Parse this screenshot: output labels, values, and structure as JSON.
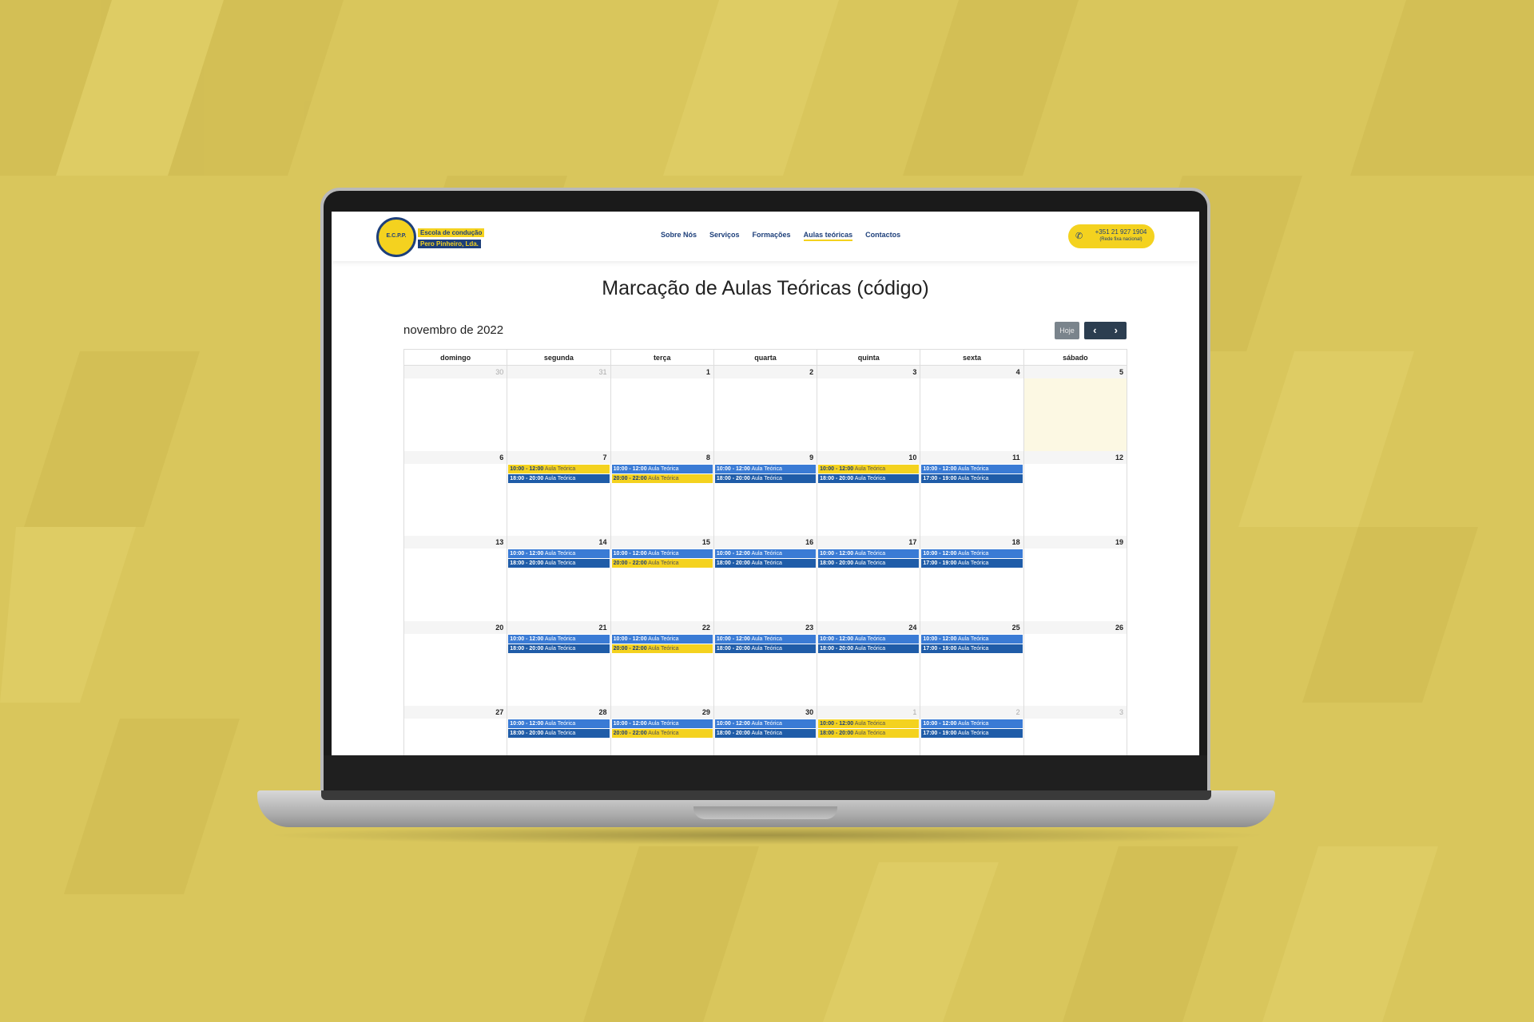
{
  "header": {
    "logo_badge": "E.C.P.P.",
    "logo_line1": "Escola de condução",
    "logo_line2": "Pero Pinheiro, Lda.",
    "nav": [
      {
        "label": "Sobre Nós",
        "active": false
      },
      {
        "label": "Serviços",
        "active": false
      },
      {
        "label": "Formações",
        "active": false
      },
      {
        "label": "Aulas teóricas",
        "active": true
      },
      {
        "label": "Contactos",
        "active": false
      }
    ],
    "phone_number": "+351 21 927 1904",
    "phone_note": "(Rede fixa nacional)"
  },
  "page_title": "Marcação de Aulas Teóricas (código)",
  "calendar": {
    "month_title": "novembro de 2022",
    "today_label": "Hoje",
    "prev_label": "‹",
    "next_label": "›",
    "weekdays": [
      "domingo",
      "segunda",
      "terça",
      "quarta",
      "quinta",
      "sexta",
      "sábado"
    ],
    "weeks": [
      [
        {
          "day": "30",
          "other": true,
          "events": []
        },
        {
          "day": "31",
          "other": true,
          "events": []
        },
        {
          "day": "1",
          "events": []
        },
        {
          "day": "2",
          "events": []
        },
        {
          "day": "3",
          "events": []
        },
        {
          "day": "4",
          "events": []
        },
        {
          "day": "5",
          "today": true,
          "events": []
        }
      ],
      [
        {
          "day": "6",
          "events": []
        },
        {
          "day": "7",
          "events": [
            {
              "time": "10:00 - 12:00",
              "name": "Aula Teórica",
              "color": "yellow"
            },
            {
              "time": "18:00 - 20:00",
              "name": "Aula Teórica",
              "color": "dblue"
            }
          ]
        },
        {
          "day": "8",
          "events": [
            {
              "time": "10:00 - 12:00",
              "name": "Aula Teórica",
              "color": "blue"
            },
            {
              "time": "20:00 - 22:00",
              "name": "Aula Teórica",
              "color": "yellow"
            }
          ]
        },
        {
          "day": "9",
          "events": [
            {
              "time": "10:00 - 12:00",
              "name": "Aula Teórica",
              "color": "blue"
            },
            {
              "time": "18:00 - 20:00",
              "name": "Aula Teórica",
              "color": "dblue"
            }
          ]
        },
        {
          "day": "10",
          "events": [
            {
              "time": "10:00 - 12:00",
              "name": "Aula Teórica",
              "color": "yellow"
            },
            {
              "time": "18:00 - 20:00",
              "name": "Aula Teórica",
              "color": "dblue"
            }
          ]
        },
        {
          "day": "11",
          "events": [
            {
              "time": "10:00 - 12:00",
              "name": "Aula Teórica",
              "color": "blue"
            },
            {
              "time": "17:00 - 19:00",
              "name": "Aula Teórica",
              "color": "dblue"
            }
          ]
        },
        {
          "day": "12",
          "events": []
        }
      ],
      [
        {
          "day": "13",
          "events": []
        },
        {
          "day": "14",
          "events": [
            {
              "time": "10:00 - 12:00",
              "name": "Aula Teórica",
              "color": "blue"
            },
            {
              "time": "18:00 - 20:00",
              "name": "Aula Teórica",
              "color": "dblue"
            }
          ]
        },
        {
          "day": "15",
          "events": [
            {
              "time": "10:00 - 12:00",
              "name": "Aula Teórica",
              "color": "blue"
            },
            {
              "time": "20:00 - 22:00",
              "name": "Aula Teórica",
              "color": "yellow"
            }
          ]
        },
        {
          "day": "16",
          "events": [
            {
              "time": "10:00 - 12:00",
              "name": "Aula Teórica",
              "color": "blue"
            },
            {
              "time": "18:00 - 20:00",
              "name": "Aula Teórica",
              "color": "dblue"
            }
          ]
        },
        {
          "day": "17",
          "events": [
            {
              "time": "10:00 - 12:00",
              "name": "Aula Teórica",
              "color": "blue"
            },
            {
              "time": "18:00 - 20:00",
              "name": "Aula Teórica",
              "color": "dblue"
            }
          ]
        },
        {
          "day": "18",
          "events": [
            {
              "time": "10:00 - 12:00",
              "name": "Aula Teórica",
              "color": "blue"
            },
            {
              "time": "17:00 - 19:00",
              "name": "Aula Teórica",
              "color": "dblue"
            }
          ]
        },
        {
          "day": "19",
          "events": []
        }
      ],
      [
        {
          "day": "20",
          "events": []
        },
        {
          "day": "21",
          "events": [
            {
              "time": "10:00 - 12:00",
              "name": "Aula Teórica",
              "color": "blue"
            },
            {
              "time": "18:00 - 20:00",
              "name": "Aula Teórica",
              "color": "dblue"
            }
          ]
        },
        {
          "day": "22",
          "events": [
            {
              "time": "10:00 - 12:00",
              "name": "Aula Teórica",
              "color": "blue"
            },
            {
              "time": "20:00 - 22:00",
              "name": "Aula Teórica",
              "color": "yellow"
            }
          ]
        },
        {
          "day": "23",
          "events": [
            {
              "time": "10:00 - 12:00",
              "name": "Aula Teórica",
              "color": "blue"
            },
            {
              "time": "18:00 - 20:00",
              "name": "Aula Teórica",
              "color": "dblue"
            }
          ]
        },
        {
          "day": "24",
          "events": [
            {
              "time": "10:00 - 12:00",
              "name": "Aula Teórica",
              "color": "blue"
            },
            {
              "time": "18:00 - 20:00",
              "name": "Aula Teórica",
              "color": "dblue"
            }
          ]
        },
        {
          "day": "25",
          "events": [
            {
              "time": "10:00 - 12:00",
              "name": "Aula Teórica",
              "color": "blue"
            },
            {
              "time": "17:00 - 19:00",
              "name": "Aula Teórica",
              "color": "dblue"
            }
          ]
        },
        {
          "day": "26",
          "events": []
        }
      ],
      [
        {
          "day": "27",
          "events": []
        },
        {
          "day": "28",
          "events": [
            {
              "time": "10:00 - 12:00",
              "name": "Aula Teórica",
              "color": "blue"
            },
            {
              "time": "18:00 - 20:00",
              "name": "Aula Teórica",
              "color": "dblue"
            }
          ]
        },
        {
          "day": "29",
          "events": [
            {
              "time": "10:00 - 12:00",
              "name": "Aula Teórica",
              "color": "blue"
            },
            {
              "time": "20:00 - 22:00",
              "name": "Aula Teórica",
              "color": "yellow"
            }
          ]
        },
        {
          "day": "30",
          "events": [
            {
              "time": "10:00 - 12:00",
              "name": "Aula Teórica",
              "color": "blue"
            },
            {
              "time": "18:00 - 20:00",
              "name": "Aula Teórica",
              "color": "dblue"
            }
          ]
        },
        {
          "day": "1",
          "other": true,
          "events": [
            {
              "time": "10:00 - 12:00",
              "name": "Aula Teórica",
              "color": "yellow"
            },
            {
              "time": "18:00 - 20:00",
              "name": "Aula Teórica",
              "color": "yellow"
            }
          ]
        },
        {
          "day": "2",
          "other": true,
          "events": [
            {
              "time": "10:00 - 12:00",
              "name": "Aula Teórica",
              "color": "blue"
            },
            {
              "time": "17:00 - 19:00",
              "name": "Aula Teórica",
              "color": "dblue"
            }
          ]
        },
        {
          "day": "3",
          "other": true,
          "events": []
        }
      ]
    ]
  },
  "colors": {
    "background": "#d9c65c",
    "brand_yellow": "#f4d21f",
    "brand_blue": "#1d3f7a",
    "event_blue": "#3a7bd5",
    "event_dark_blue": "#1f5ca8",
    "today_highlight": "#fcf8e3"
  }
}
